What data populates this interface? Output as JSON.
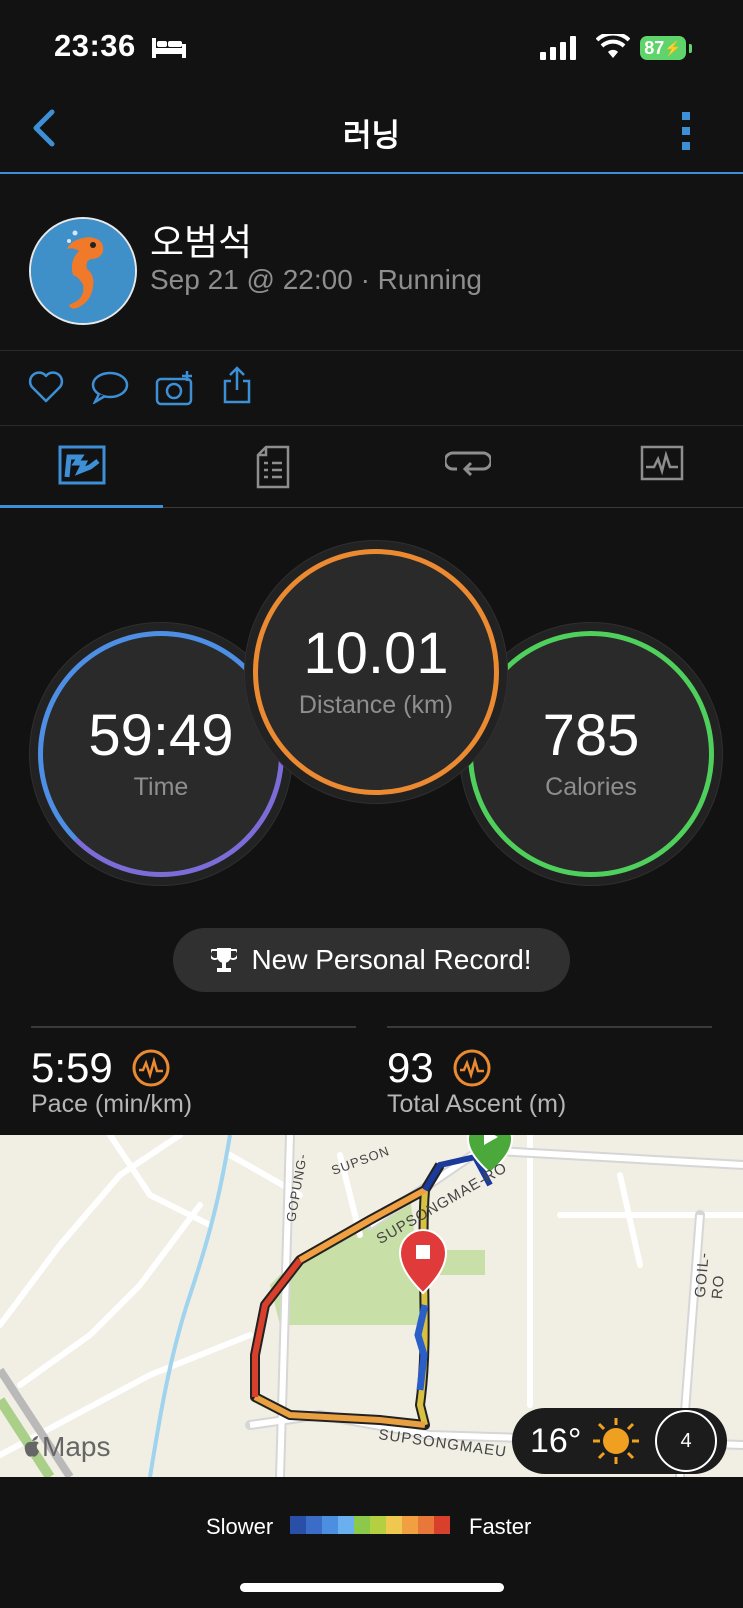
{
  "status_bar": {
    "time": "23:36",
    "battery": "87"
  },
  "nav": {
    "title": "러닝"
  },
  "profile": {
    "name": "오범석",
    "meta": "Sep 21 @ 22:00 · Running"
  },
  "stats": {
    "time": {
      "value": "59:49",
      "label": "Time"
    },
    "distance": {
      "value": "10.01",
      "label": "Distance (km)"
    },
    "calories": {
      "value": "785",
      "label": "Calories"
    }
  },
  "record_label": "New Personal Record!",
  "metrics": {
    "pace": {
      "value": "5:59",
      "label": "Pace (min/km)"
    },
    "ascent": {
      "value": "93",
      "label": "Total Ascent (m)"
    }
  },
  "map": {
    "streets": [
      "SUPSONGMAE-RO",
      "SUPSONGMAEU",
      "GOPUNG-",
      "GOIL-RO",
      "SUPSON"
    ],
    "attribution": "Maps",
    "weather_temp": "16°",
    "wind": "4"
  },
  "legend": {
    "slower": "Slower",
    "faster": "Faster",
    "colors": [
      "#2a4fa8",
      "#3a6cc8",
      "#4c8ee0",
      "#6ab0ef",
      "#8cc84a",
      "#b4d040",
      "#f0c850",
      "#f0a040",
      "#e8783a",
      "#d8402c"
    ]
  }
}
